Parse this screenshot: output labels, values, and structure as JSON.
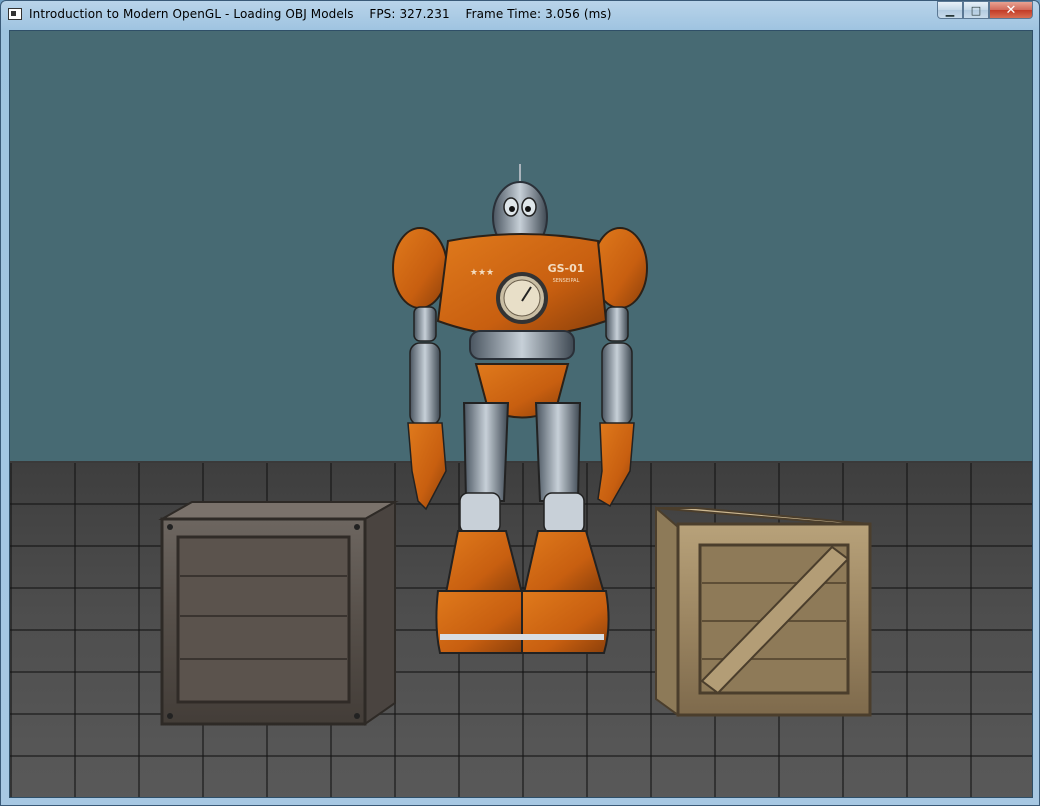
{
  "window": {
    "title": "Introduction to Modern OpenGL - Loading OBJ Models",
    "fps_label": "FPS: 327.231",
    "frame_time_label": "Frame Time: 3.056 (ms)",
    "controls": {
      "minimize": "▁",
      "maximize": "□",
      "close": "✕"
    }
  },
  "scene": {
    "background_color": "#476a73",
    "robot_chest_text": "GS-01",
    "robot_chest_subtext": "SENSEIPAL",
    "robot_stars": "★★★"
  }
}
